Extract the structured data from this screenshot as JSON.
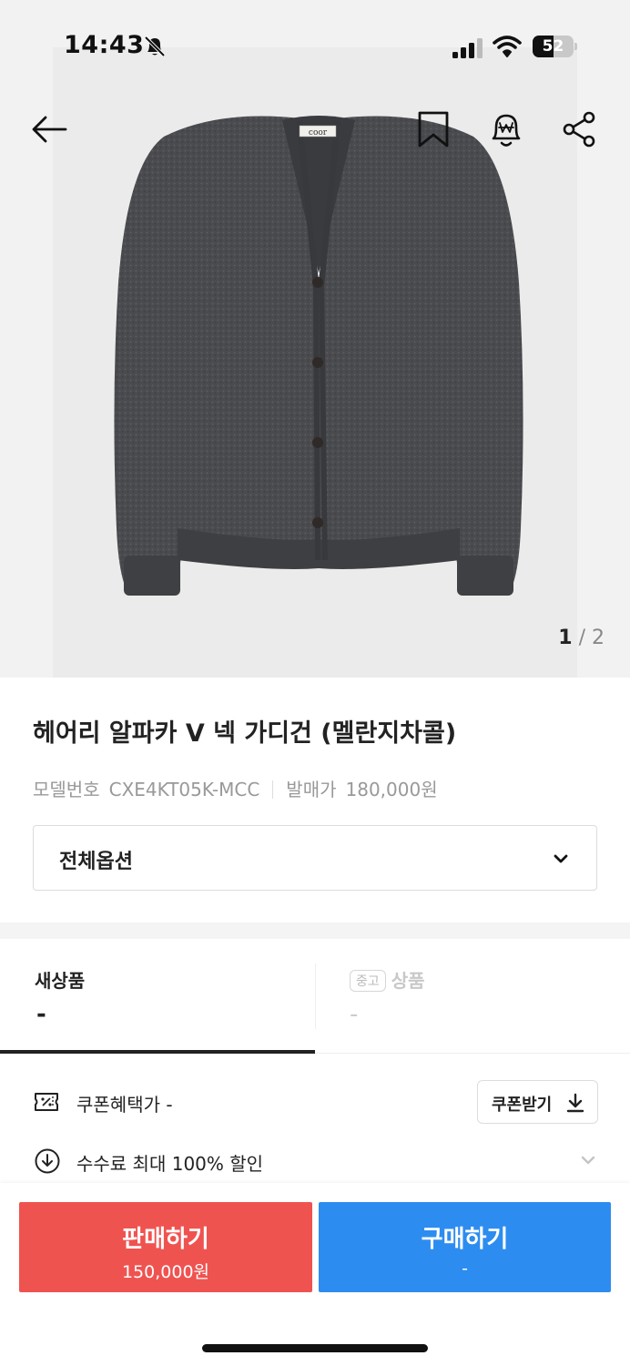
{
  "status_bar": {
    "time": "14:43",
    "battery": "52",
    "battery_level": 0.52
  },
  "hero": {
    "brand_tag": "coor",
    "pager_current": "1",
    "pager_separator": " / ",
    "pager_total": "2"
  },
  "product": {
    "title": "헤어리 알파카 V 넥 가디건 (멜란지차콜)",
    "model_label": "모델번호",
    "model_value": "CXE4KT05K-MCC",
    "release_label": "발매가",
    "release_value": "180,000원",
    "option_label": "전체옵션"
  },
  "tabs": {
    "new_title": "새상품",
    "new_price": "-",
    "used_badge": "중고",
    "used_title": "상품",
    "used_price": "-"
  },
  "benefits": {
    "coupon_text": "쿠폰혜택가 -",
    "coupon_button": "쿠폰받기",
    "fee_text": "수수료 최대 100% 할인"
  },
  "actions": {
    "sell_label": "판매하기",
    "sell_price": "150,000원",
    "buy_label": "구매하기",
    "buy_price": "-"
  },
  "colors": {
    "sell": "#ef5350",
    "buy": "#2d8cf0",
    "text": "#222222",
    "muted": "#999999"
  },
  "icons": [
    "back-arrow-icon",
    "bookmark-icon",
    "price-alert-bell-icon",
    "share-icon",
    "coupon-icon",
    "download-icon",
    "discount-badge-icon",
    "chevron-down-icon"
  ]
}
